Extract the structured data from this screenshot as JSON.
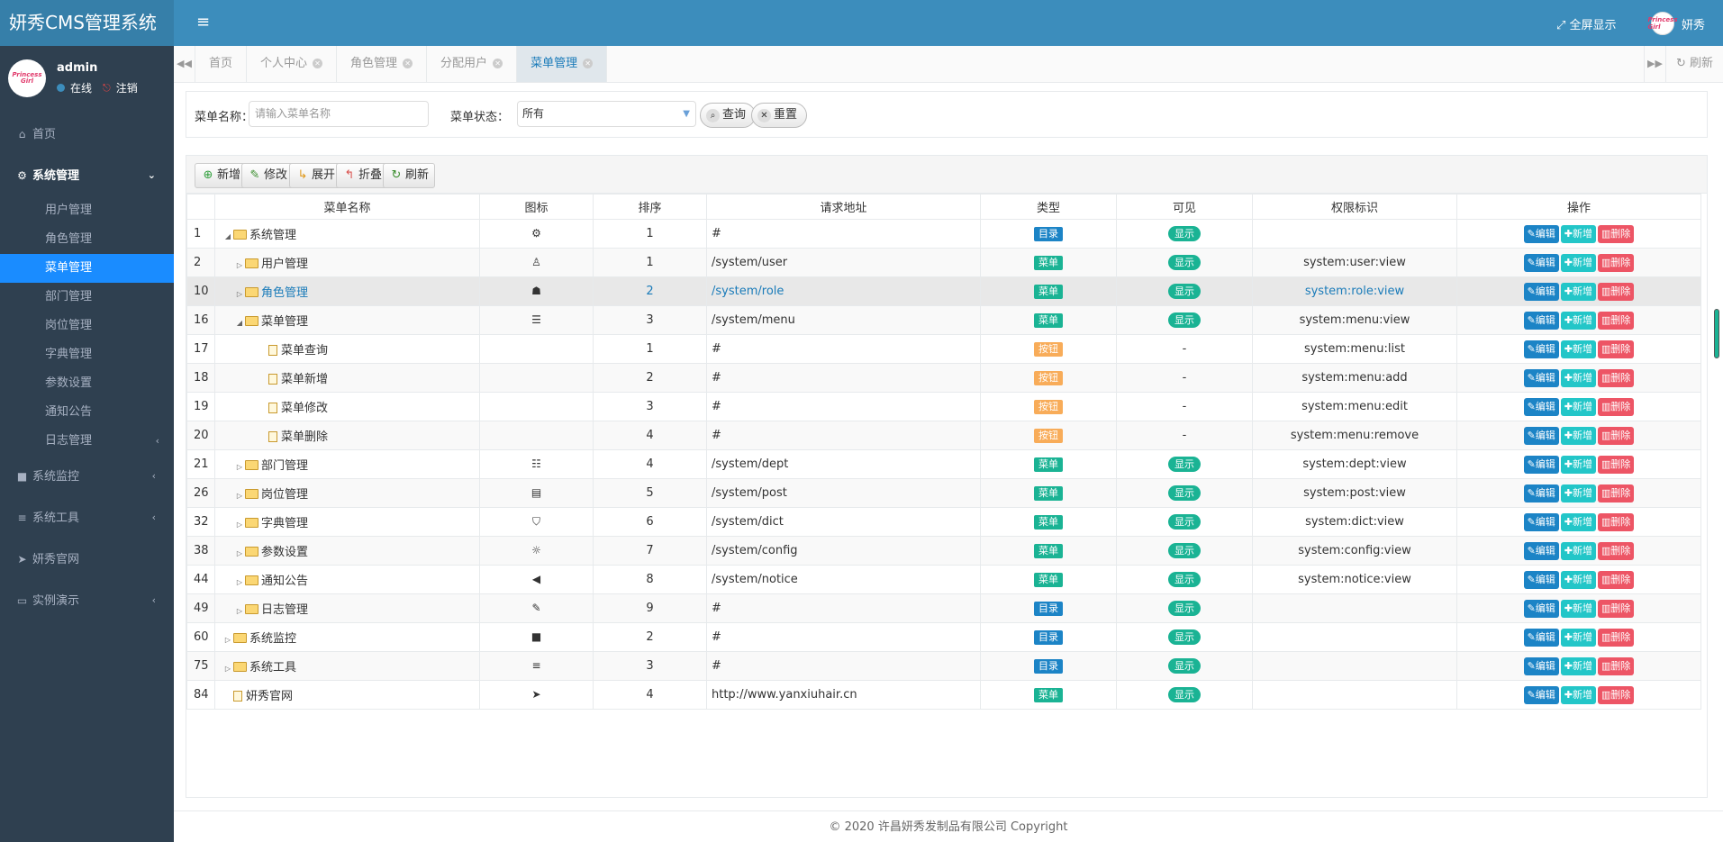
{
  "app": {
    "title": "妍秀CMS管理系统",
    "fullscreen_label": "全屏显示",
    "top_user": "妍秀"
  },
  "avatar_text": "Princess Girl",
  "user": {
    "name": "admin",
    "status": "在线",
    "logout": "注销"
  },
  "sidebar": {
    "home": "首页",
    "system": "系统管理",
    "subs": [
      "用户管理",
      "角色管理",
      "菜单管理",
      "部门管理",
      "岗位管理",
      "字典管理",
      "参数设置",
      "通知公告",
      "日志管理"
    ],
    "monitor": "系统监控",
    "tools": "系统工具",
    "website": "妍秀官网",
    "demo": "实例演示"
  },
  "tabs": [
    "首页",
    "个人中心",
    "角色管理",
    "分配用户",
    "菜单管理"
  ],
  "tabs_refresh": "刷新",
  "search": {
    "name_label": "菜单名称：",
    "name_placeholder": "请输入菜单名称",
    "status_label": "菜单状态：",
    "status_value": "所有",
    "query_label": "查询",
    "reset_label": "重置"
  },
  "toolbar": {
    "add": "新增",
    "edit": "修改",
    "expand": "展开",
    "collapse": "折叠",
    "refresh": "刷新"
  },
  "columns": [
    "菜单名称",
    "图标",
    "排序",
    "请求地址",
    "类型",
    "可见",
    "权限标识",
    "操作"
  ],
  "actions": {
    "edit": "编辑",
    "add": "新增",
    "delete": "删除"
  },
  "rows": [
    {
      "id": "1",
      "level": 0,
      "toggle": "open",
      "node": "folder",
      "name": "系统管理",
      "icon": "gear-icon",
      "glyph": "⚙",
      "order": "1",
      "url": "#",
      "type": "目录",
      "type_color": "blue",
      "visible": "显示",
      "perm": ""
    },
    {
      "id": "2",
      "level": 1,
      "toggle": "closed",
      "node": "folder",
      "name": "用户管理",
      "icon": "user-icon",
      "glyph": "♙",
      "order": "1",
      "url": "/system/user",
      "type": "菜单",
      "type_color": "green",
      "visible": "显示",
      "perm": "system:user:view"
    },
    {
      "id": "10",
      "level": 1,
      "toggle": "closed",
      "node": "folder",
      "name": "角色管理",
      "icon": "user-secret-icon",
      "glyph": "☗",
      "order": "2",
      "url": "/system/role",
      "type": "菜单",
      "type_color": "green",
      "visible": "显示",
      "perm": "system:role:view",
      "highlight": true
    },
    {
      "id": "16",
      "level": 1,
      "toggle": "open",
      "node": "folder",
      "name": "菜单管理",
      "icon": "th-list-icon",
      "glyph": "☰",
      "order": "3",
      "url": "/system/menu",
      "type": "菜单",
      "type_color": "green",
      "visible": "显示",
      "perm": "system:menu:view"
    },
    {
      "id": "17",
      "level": 2,
      "toggle": "none",
      "node": "file",
      "name": "菜单查询",
      "icon": "",
      "glyph": "",
      "order": "1",
      "url": "#",
      "type": "按钮",
      "type_color": "orange",
      "visible": "-",
      "perm": "system:menu:list"
    },
    {
      "id": "18",
      "level": 2,
      "toggle": "none",
      "node": "file",
      "name": "菜单新增",
      "icon": "",
      "glyph": "",
      "order": "2",
      "url": "#",
      "type": "按钮",
      "type_color": "orange",
      "visible": "-",
      "perm": "system:menu:add"
    },
    {
      "id": "19",
      "level": 2,
      "toggle": "none",
      "node": "file",
      "name": "菜单修改",
      "icon": "",
      "glyph": "",
      "order": "3",
      "url": "#",
      "type": "按钮",
      "type_color": "orange",
      "visible": "-",
      "perm": "system:menu:edit"
    },
    {
      "id": "20",
      "level": 2,
      "toggle": "none",
      "node": "file",
      "name": "菜单删除",
      "icon": "",
      "glyph": "",
      "order": "4",
      "url": "#",
      "type": "按钮",
      "type_color": "orange",
      "visible": "-",
      "perm": "system:menu:remove"
    },
    {
      "id": "21",
      "level": 1,
      "toggle": "closed",
      "node": "folder",
      "name": "部门管理",
      "icon": "outdent-icon",
      "glyph": "☷",
      "order": "4",
      "url": "/system/dept",
      "type": "菜单",
      "type_color": "green",
      "visible": "显示",
      "perm": "system:dept:view"
    },
    {
      "id": "26",
      "level": 1,
      "toggle": "closed",
      "node": "folder",
      "name": "岗位管理",
      "icon": "address-card-icon",
      "glyph": "▤",
      "order": "5",
      "url": "/system/post",
      "type": "菜单",
      "type_color": "green",
      "visible": "显示",
      "perm": "system:post:view"
    },
    {
      "id": "32",
      "level": 1,
      "toggle": "closed",
      "node": "folder",
      "name": "字典管理",
      "icon": "bookmark-icon",
      "glyph": "⛉",
      "order": "6",
      "url": "/system/dict",
      "type": "菜单",
      "type_color": "green",
      "visible": "显示",
      "perm": "system:dict:view"
    },
    {
      "id": "38",
      "level": 1,
      "toggle": "closed",
      "node": "folder",
      "name": "参数设置",
      "icon": "sun-icon",
      "glyph": "☼",
      "order": "7",
      "url": "/system/config",
      "type": "菜单",
      "type_color": "green",
      "visible": "显示",
      "perm": "system:config:view"
    },
    {
      "id": "44",
      "level": 1,
      "toggle": "closed",
      "node": "folder",
      "name": "通知公告",
      "icon": "bullhorn-icon",
      "glyph": "◀",
      "order": "8",
      "url": "/system/notice",
      "type": "菜单",
      "type_color": "green",
      "visible": "显示",
      "perm": "system:notice:view"
    },
    {
      "id": "49",
      "level": 1,
      "toggle": "closed",
      "node": "folder",
      "name": "日志管理",
      "icon": "edit-icon",
      "glyph": "✎",
      "order": "9",
      "url": "#",
      "type": "目录",
      "type_color": "blue",
      "visible": "显示",
      "perm": ""
    },
    {
      "id": "60",
      "level": 0,
      "toggle": "closed",
      "node": "folder",
      "name": "系统监控",
      "icon": "video-camera-icon",
      "glyph": "■",
      "order": "2",
      "url": "#",
      "type": "目录",
      "type_color": "blue",
      "visible": "显示",
      "perm": ""
    },
    {
      "id": "75",
      "level": 0,
      "toggle": "closed",
      "node": "folder",
      "name": "系统工具",
      "icon": "bars-icon",
      "glyph": "≡",
      "order": "3",
      "url": "#",
      "type": "目录",
      "type_color": "blue",
      "visible": "显示",
      "perm": ""
    },
    {
      "id": "84",
      "level": 0,
      "toggle": "none",
      "node": "file",
      "name": "妍秀官网",
      "icon": "location-arrow-icon",
      "glyph": "➤",
      "order": "4",
      "url": "http://www.yanxiuhair.cn",
      "type": "菜单",
      "type_color": "green",
      "visible": "显示",
      "perm": ""
    }
  ],
  "footer": "© 2020 许昌妍秀发制品有限公司 Copyright"
}
